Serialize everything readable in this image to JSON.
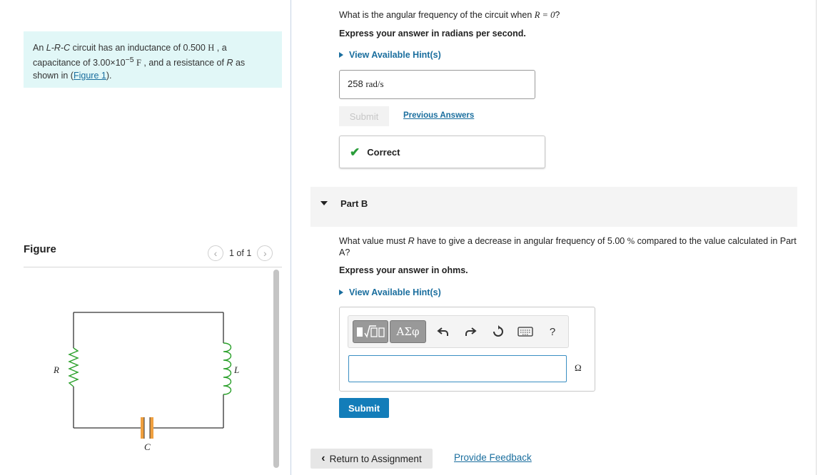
{
  "problem": {
    "intro_pre": "An ",
    "circuit_type": "L-R-C",
    "intro_mid": " circuit has an inductance of 0.500 ",
    "inductance_unit": "H",
    "cap_pre": " , a capacitance of 3.00×10",
    "cap_exp": "−5",
    "cap_unit": "F",
    "cap_post": " , and a resistance of ",
    "resistance_var": "R",
    "resistance_post": " as shown in (",
    "figure_link": "Figure 1",
    "close": ")."
  },
  "figure": {
    "title": "Figure",
    "counter": "1 of 1",
    "prev_icon": "chevron-left-icon",
    "next_icon": "chevron-right-icon",
    "labels": {
      "R": "R",
      "L": "L",
      "C": "C"
    },
    "colors": {
      "wire": "#333333",
      "inductor": "#2aa02a",
      "resistor": "#2aa02a",
      "capacitor": "#f0a040"
    }
  },
  "part_a": {
    "question_pre": "What is the angular frequency of the circuit when ",
    "question_math": "R = 0",
    "question_post": "?",
    "instruction": "Express your answer in radians per second.",
    "hint_label": "View Available Hint(s)",
    "answer_value": "258",
    "answer_unit": "rad/s",
    "submit_label": "Submit",
    "previous_answers_label": "Previous Answers",
    "feedback_label": "Correct"
  },
  "part_b": {
    "label": "Part B",
    "question_pre": "What value must ",
    "question_var": "R",
    "question_mid": " have to give a decrease in angular frequency of 5.00 ",
    "question_pct": "%",
    "question_post": " compared to the value calculated in Part A?",
    "instruction": "Express your answer in ohms.",
    "hint_label": "View Available Hint(s)",
    "greek_label": "ΑΣφ",
    "unit": "Ω",
    "input_value": "",
    "submit_label": "Submit",
    "toolbar_icons": [
      "templates-icon",
      "greek-symbols-icon",
      "undo-icon",
      "redo-icon",
      "reset-icon",
      "keyboard-icon",
      "help-icon"
    ],
    "help_label": "?"
  },
  "footer": {
    "return_label": "Return to Assignment",
    "feedback_label": "Provide Feedback"
  },
  "colors": {
    "accent": "#137db9",
    "link": "#1a6e9e",
    "problem_bg": "#e1f7f7",
    "correct": "#2a9d3a"
  }
}
